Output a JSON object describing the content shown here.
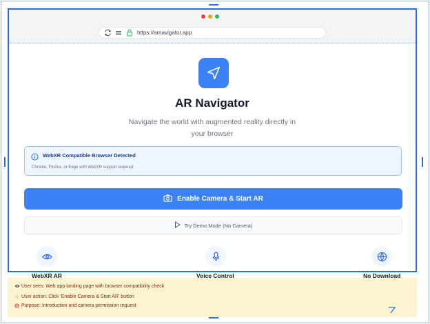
{
  "browser": {
    "url": "https://arnavigator.app"
  },
  "app": {
    "title": "AR Navigator",
    "subtitle": "Navigate the world with augmented reality directly in your browser"
  },
  "notice": {
    "title": "WebXR Compatible Browser Detected",
    "subtitle": "Chrome, Firefox, or Edge with WebXR support required"
  },
  "buttons": {
    "primary": "Enable Camera & Start AR",
    "secondary": "Try Demo Mode (No Camera)"
  },
  "features": [
    {
      "label": "WebXR AR",
      "icon": "eye-icon"
    },
    {
      "label": "Voice Control",
      "icon": "microphone-icon"
    },
    {
      "label": "No Download",
      "icon": "globe-icon"
    }
  ],
  "notes": [
    {
      "text": "User sees: Web app landing page with browser compatibility check"
    },
    {
      "text": "User action: Click 'Enable Camera & Start AR' button"
    },
    {
      "text": "Purpose: Introduction and camera permission request"
    }
  ],
  "colors": {
    "accent": "#3b82f6",
    "notice_bg": "#eff6ff",
    "notes_bg": "#fdf4cf"
  }
}
